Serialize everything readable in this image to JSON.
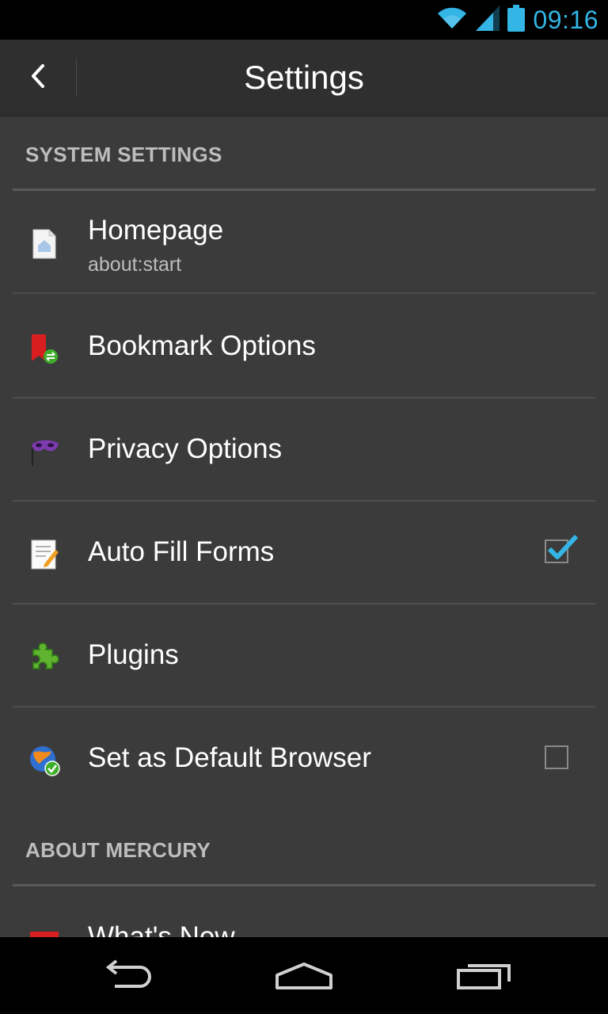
{
  "status_bar": {
    "time": "09:16",
    "icons": [
      "wifi-icon",
      "signal-icon",
      "battery-icon"
    ],
    "accent_color": "#33b5e5"
  },
  "action_bar": {
    "title": "Settings",
    "back_icon": "chevron-left-icon"
  },
  "sections": {
    "system": {
      "header": "SYSTEM SETTINGS",
      "items": [
        {
          "title": "Homepage",
          "summary": "about:start",
          "icon": "home-page-icon"
        },
        {
          "title": "Bookmark Options",
          "icon": "bookmark-icon"
        },
        {
          "title": "Privacy Options",
          "icon": "mask-icon"
        },
        {
          "title": "Auto Fill Forms",
          "icon": "notepad-icon",
          "checked": true
        },
        {
          "title": "Plugins",
          "icon": "puzzle-icon"
        },
        {
          "title": "Set as Default Browser",
          "icon": "globe-check-icon",
          "checked": false
        }
      ]
    },
    "about": {
      "header": "ABOUT MERCURY",
      "items": [
        {
          "title": "What's New",
          "icon": "calendar-icon"
        }
      ]
    }
  },
  "nav_bar": {
    "icons": [
      "back-nav-icon",
      "home-nav-icon",
      "recent-apps-icon"
    ]
  }
}
